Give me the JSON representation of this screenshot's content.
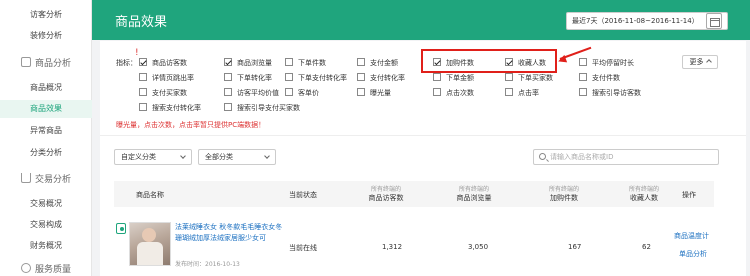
{
  "sidebar": {
    "items_top": [
      "访客分析",
      "装修分析"
    ],
    "group_goods": "商品分析",
    "goods_items": [
      "商品概况",
      "商品效果",
      "异常商品",
      "分类分析"
    ],
    "group_trade": "交易分析",
    "trade_items": [
      "交易概况",
      "交易构成",
      "财务概况"
    ],
    "group_service": "服务质量"
  },
  "header": {
    "title": "商品效果",
    "date_range": "最近7天（2016-11-08~2016-11-14）"
  },
  "indicators": {
    "label": "指标：",
    "red_mark": "!",
    "items": [
      {
        "label": "商品访客数",
        "checked": true
      },
      {
        "label": "商品浏览量",
        "checked": true
      },
      {
        "label": "下单件数",
        "checked": false
      },
      {
        "label": "支付金额",
        "checked": false
      },
      {
        "label": "加购件数",
        "checked": true
      },
      {
        "label": "收藏人数",
        "checked": true
      },
      {
        "label": "平均停留时长",
        "checked": false
      },
      {
        "label": "详情页跳出率",
        "checked": false
      },
      {
        "label": "下单转化率",
        "checked": false
      },
      {
        "label": "下单支付转化率",
        "checked": false
      },
      {
        "label": "支付转化率",
        "checked": false
      },
      {
        "label": "下单金额",
        "checked": false
      },
      {
        "label": "下单买家数",
        "checked": false
      },
      {
        "label": "支付件数",
        "checked": false
      },
      {
        "label": "支付买家数",
        "checked": false
      },
      {
        "label": "访客平均价值",
        "checked": false
      },
      {
        "label": "客单价",
        "checked": false
      },
      {
        "label": "曝光量",
        "checked": false
      },
      {
        "label": "点击次数",
        "checked": false
      },
      {
        "label": "点击率",
        "checked": false
      },
      {
        "label": "搜索引导访客数",
        "checked": false
      },
      {
        "label": "搜索支付转化率",
        "checked": false
      },
      {
        "label": "搜索引导支付买家数",
        "checked": false
      }
    ],
    "more": "更多",
    "hint": "曝光量，点击次数，点击率暂只提供PC端数据！",
    "highlight_color": "#e0201a"
  },
  "filters": {
    "category": "自定义分类",
    "all_category": "全部分类",
    "search_placeholder": "请输入商品名称或ID"
  },
  "table": {
    "headers": {
      "name": "商品名称",
      "status": "当前状态",
      "sub": "所有终端的",
      "visitors": "商品访客数",
      "views": "商品浏览量",
      "cart": "加购件数",
      "fav": "收藏人数",
      "op": "操作"
    },
    "rows": [
      {
        "name": "法莱绒睡衣女 秋冬款毛毛睡衣女冬 珊瑚绒加厚法绒家居服少女可",
        "publish_time": "发布时间：2016-10-13",
        "status": "当前在线",
        "visitors": "1,312",
        "views": "3,050",
        "cart": "167",
        "fav": "62",
        "op1": "商品温度计",
        "op2": "单品分析"
      }
    ]
  },
  "colors": {
    "brand": "#1fa57d",
    "link": "#1a6fc0",
    "alert": "#d33"
  }
}
